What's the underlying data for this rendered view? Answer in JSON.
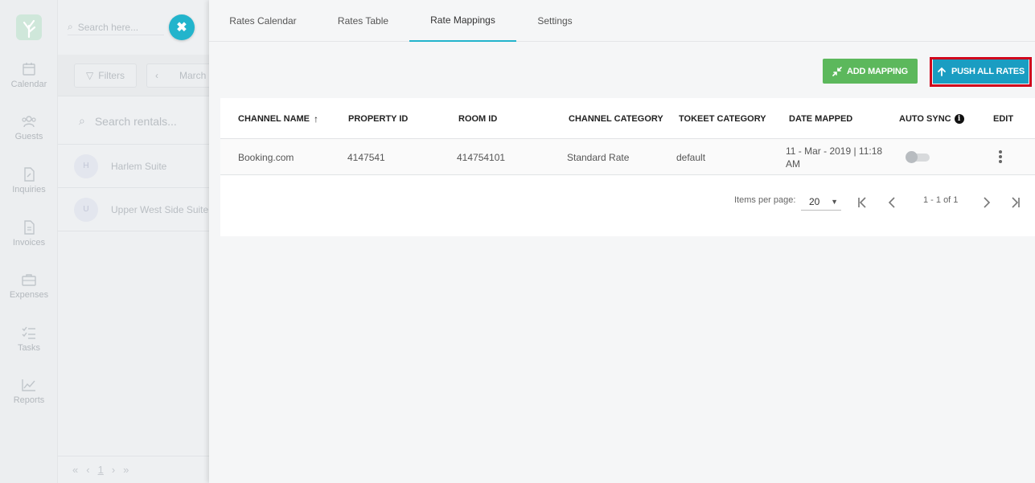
{
  "sidebar": {
    "items": [
      {
        "label": "Calendar",
        "icon": "calendar-icon"
      },
      {
        "label": "Guests",
        "icon": "guests-icon"
      },
      {
        "label": "Inquiries",
        "icon": "inquiries-icon"
      },
      {
        "label": "Invoices",
        "icon": "invoices-icon"
      },
      {
        "label": "Expenses",
        "icon": "expenses-icon"
      },
      {
        "label": "Tasks",
        "icon": "tasks-icon"
      },
      {
        "label": "Reports",
        "icon": "reports-icon"
      }
    ]
  },
  "background": {
    "search_placeholder": "Search here...",
    "filters_label": "Filters",
    "month_label": "March",
    "rental_search_placeholder": "Search rentals...",
    "rentals": [
      {
        "initial": "H",
        "name": "Harlem Suite"
      },
      {
        "initial": "U",
        "name": "Upper West Side Suite"
      }
    ],
    "pager_page": "1"
  },
  "tabs": [
    {
      "label": "Rates Calendar"
    },
    {
      "label": "Rates Table"
    },
    {
      "label": "Rate Mappings"
    },
    {
      "label": "Settings"
    }
  ],
  "active_tab": "Rate Mappings",
  "actions": {
    "add_mapping": "ADD MAPPING",
    "push_all_rates": "PUSH ALL RATES"
  },
  "table": {
    "columns": [
      "CHANNEL NAME",
      "PROPERTY ID",
      "ROOM ID",
      "CHANNEL CATEGORY",
      "TOKEET CATEGORY",
      "DATE MAPPED",
      "AUTO SYNC",
      "EDIT"
    ],
    "sort_column": "CHANNEL NAME",
    "sort_direction": "ascending",
    "rows": [
      {
        "channel_name": "Booking.com",
        "property_id": "4147541",
        "room_id": "414754101",
        "channel_category": "Standard Rate",
        "tokeet_category": "default",
        "date_mapped_line1": "11 - Mar - 2019 | 11:18",
        "date_mapped_line2": "AM",
        "auto_sync": false
      }
    ]
  },
  "paginator": {
    "items_per_page_label": "Items per page:",
    "items_per_page": "20",
    "range": "1 - 1 of 1"
  },
  "colors": {
    "accent": "#22b4cc",
    "add_button": "#5cb85c",
    "push_button": "#1a9dc2",
    "highlight_frame": "#d0021b"
  }
}
